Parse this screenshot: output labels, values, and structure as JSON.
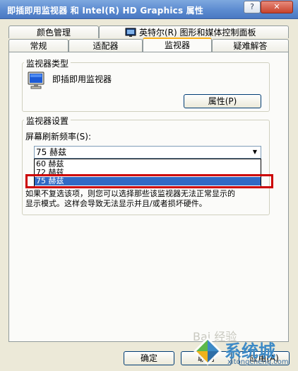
{
  "window": {
    "title": "即插即用监视器 和 Intel(R) HD Graphics 属性",
    "help_label": "?",
    "close_label": "✕"
  },
  "tabs_top": [
    "颜色管理",
    "英特尔(R) 图形和媒体控制面板"
  ],
  "tabs_bottom": [
    "常规",
    "适配器",
    "监视器",
    "疑难解答"
  ],
  "active_tab": "监视器",
  "monitor_type": {
    "group_title": "监视器类型",
    "monitor_name": "即插即用监视器",
    "properties_button": "属性(P)"
  },
  "monitor_settings": {
    "group_title": "监视器设置",
    "refresh_label": "屏幕刷新频率(S):",
    "refresh_selected": "75 赫兹",
    "refresh_options": [
      "60 赫兹",
      "72 赫兹",
      "75 赫兹"
    ],
    "highlighted_option": "75 赫兹",
    "warning_text_line1": "如果不复选该项，则您可以选择那些该监视器无法正常显示的",
    "warning_text_line2": "显示模式。这样会导致无法显示并且/或者损坏硬件。"
  },
  "footer_buttons": {
    "ok": "确定",
    "cancel": "取消",
    "apply": "应用(A)"
  },
  "watermark": {
    "site_text": "系统城",
    "site_url": "xitongcheng.com",
    "baidu_text": "Bai 经验"
  },
  "colors": {
    "titlebar": "#5c8bd0",
    "highlight_box": "#cc0000",
    "selection": "#316ac5"
  }
}
